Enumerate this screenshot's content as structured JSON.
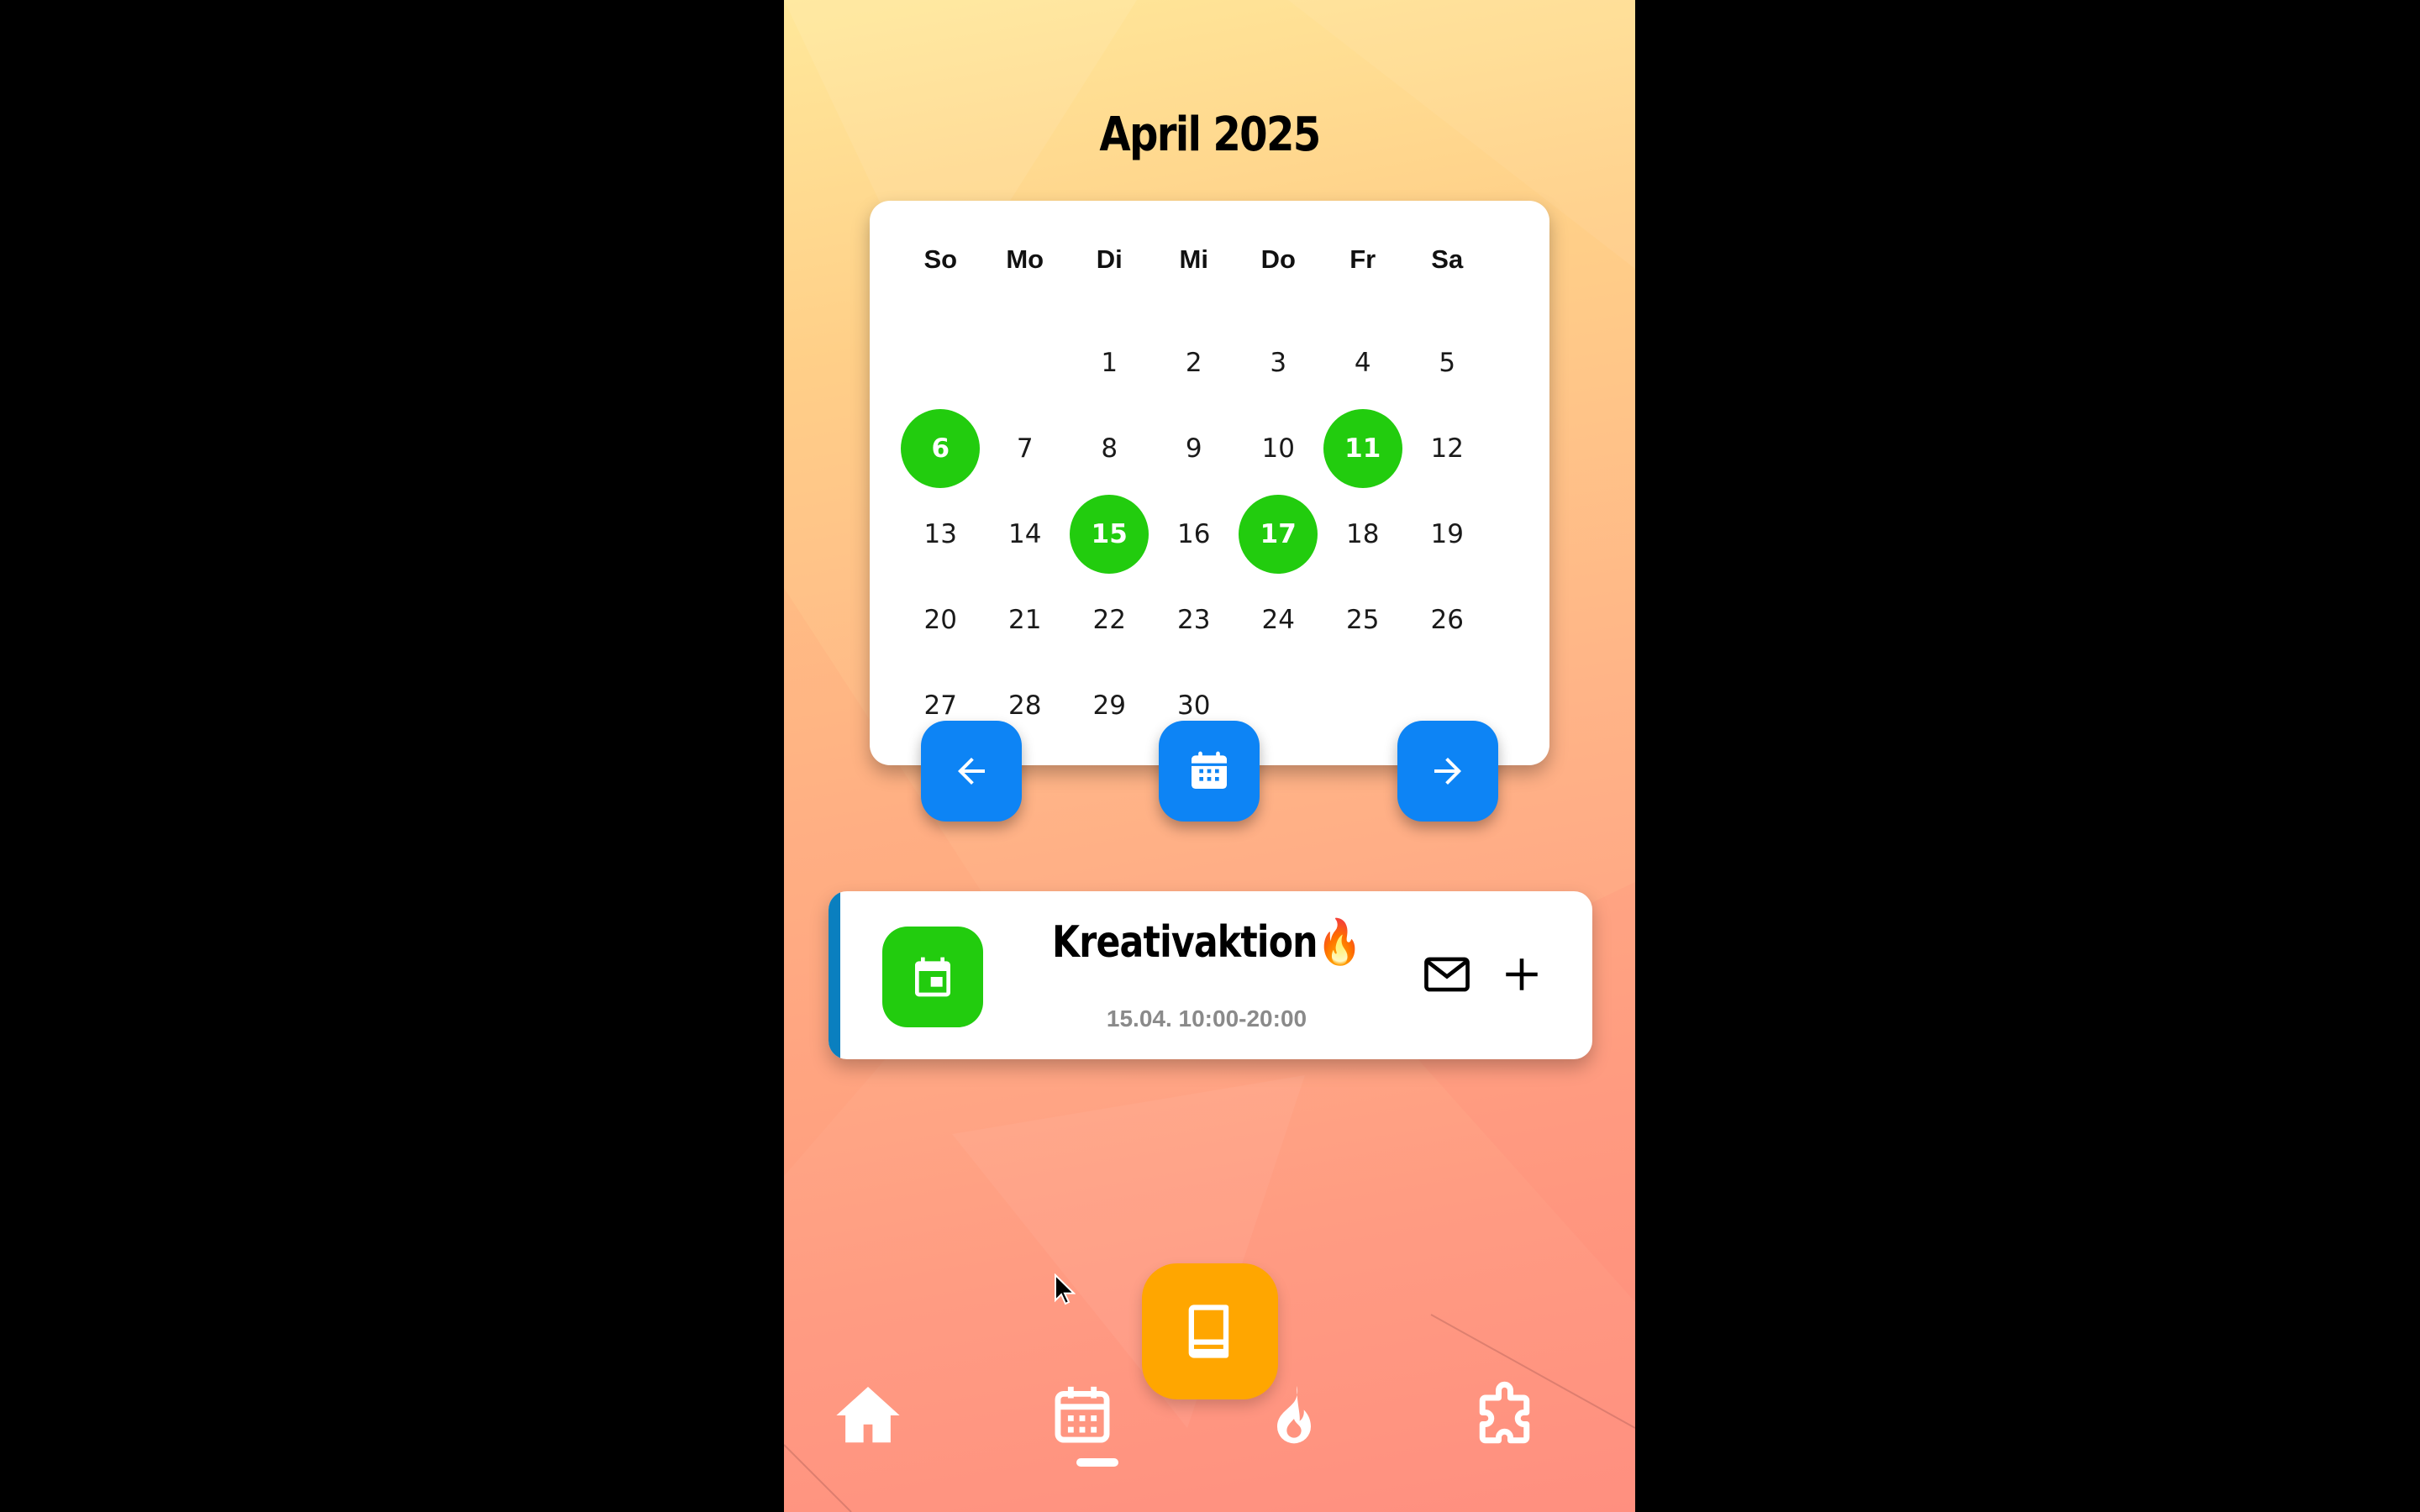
{
  "header": {
    "month_title": "April 2025"
  },
  "calendar": {
    "weekdays": [
      "So",
      "Mo",
      "Di",
      "Mi",
      "Do",
      "Fr",
      "Sa"
    ],
    "weeks": [
      [
        "",
        "",
        "1",
        "2",
        "3",
        "4",
        "5"
      ],
      [
        "6",
        "7",
        "8",
        "9",
        "10",
        "11",
        "12"
      ],
      [
        "13",
        "14",
        "15",
        "16",
        "17",
        "18",
        "19"
      ],
      [
        "20",
        "21",
        "22",
        "23",
        "24",
        "25",
        "26"
      ],
      [
        "27",
        "28",
        "29",
        "30",
        "",
        "",
        ""
      ]
    ],
    "highlighted_days": [
      "6",
      "11",
      "15",
      "17"
    ],
    "highlight_color": "#22cc0e",
    "nav": {
      "prev_icon": "arrow-left-icon",
      "today_icon": "calendar-icon",
      "next_icon": "arrow-right-icon",
      "button_color": "#0d84f5"
    }
  },
  "event": {
    "icon": "calendar-event-icon",
    "title": "Kreativaktion🔥",
    "time": "15.04. 10:00-20:00",
    "actions": {
      "mail_icon": "mail-icon",
      "add_icon": "plus-icon"
    },
    "accent_color": "#0a7fbf"
  },
  "fab": {
    "icon": "book-icon",
    "color": "#ffa600"
  },
  "tabbar": {
    "tabs": [
      {
        "icon": "home-icon"
      },
      {
        "icon": "calendar-icon",
        "active": true
      },
      {
        "icon": "flame-icon"
      },
      {
        "icon": "puzzle-icon"
      }
    ]
  }
}
